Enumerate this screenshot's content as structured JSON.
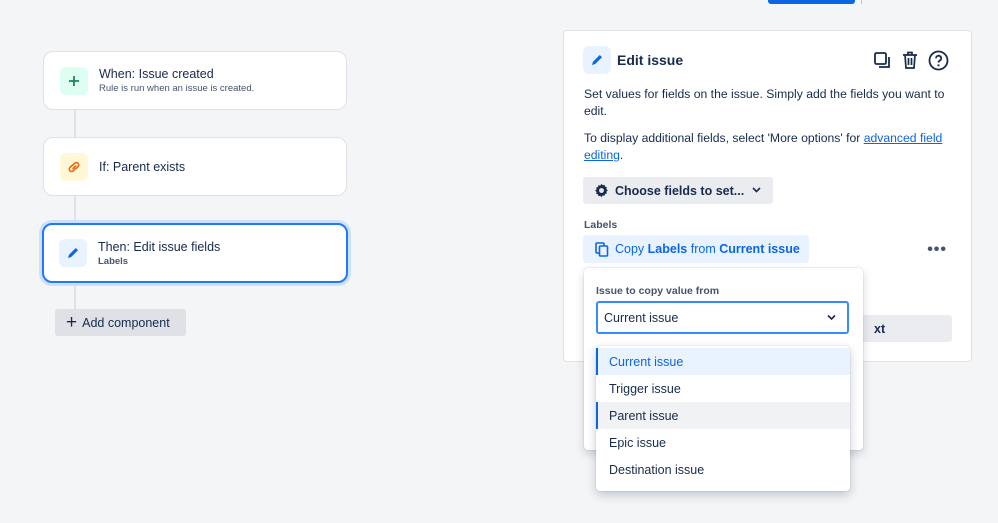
{
  "rule": {
    "trigger": {
      "title": "When: Issue created",
      "subtitle": "Rule is run when an issue is created."
    },
    "condition": {
      "title": "If: Parent exists"
    },
    "action": {
      "title": "Then: Edit issue fields",
      "subtitle": "Labels"
    },
    "add_component": "Add component"
  },
  "panel": {
    "title": "Edit issue",
    "desc1": "Set values for fields on the issue. Simply add the fields you want to edit.",
    "desc2_prefix": "To display additional fields, select 'More options' for ",
    "desc2_link": "advanced field editing",
    "desc2_suffix": ".",
    "choose_fields": "Choose fields to set...",
    "labels_label": "Labels",
    "copy_prefix": "Copy ",
    "copy_field": "Labels",
    "copy_mid": " from ",
    "copy_source": "Current issue",
    "next_button_partial": "xt"
  },
  "popover": {
    "label": "Issue to copy value from",
    "selected": "Current issue",
    "options": [
      "Current issue",
      "Trigger issue",
      "Parent issue",
      "Epic issue",
      "Destination issue"
    ]
  },
  "colors": {
    "accent": "#0c66e4",
    "focus": "#388bff",
    "selected_bg": "#e9f2ff"
  },
  "icons": {
    "trigger": "plus-icon",
    "condition": "link-icon",
    "action": "pencil-icon",
    "duplicate": "duplicate-icon",
    "delete": "trash-icon",
    "help": "help-icon",
    "settings": "gear-icon",
    "copy": "copy-icon",
    "more": "more-icon",
    "caret": "chevron-down-icon"
  }
}
